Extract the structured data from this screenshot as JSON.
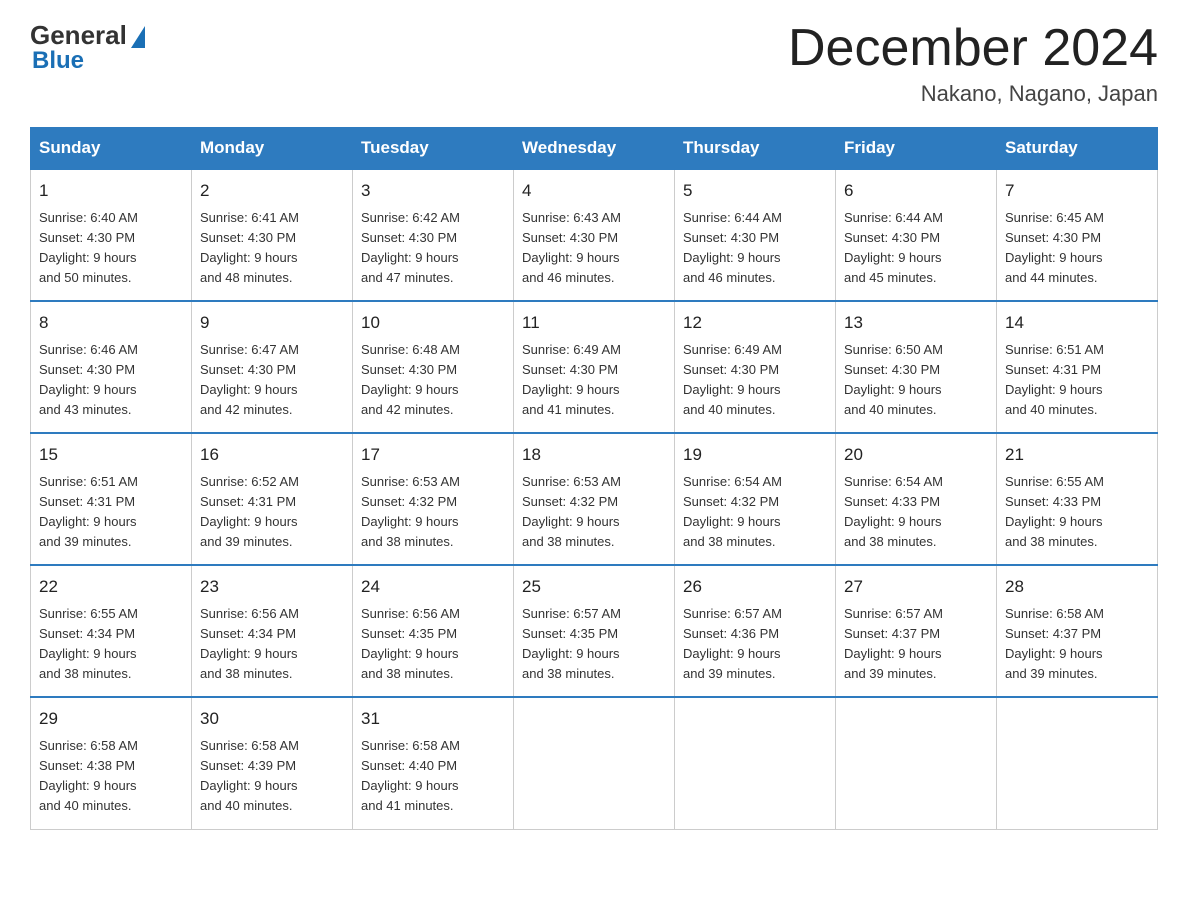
{
  "logo": {
    "general": "General",
    "blue": "Blue"
  },
  "header": {
    "title": "December 2024",
    "subtitle": "Nakano, Nagano, Japan"
  },
  "days_of_week": [
    "Sunday",
    "Monday",
    "Tuesday",
    "Wednesday",
    "Thursday",
    "Friday",
    "Saturday"
  ],
  "weeks": [
    [
      {
        "day": "1",
        "sunrise": "6:40 AM",
        "sunset": "4:30 PM",
        "daylight": "9 hours and 50 minutes."
      },
      {
        "day": "2",
        "sunrise": "6:41 AM",
        "sunset": "4:30 PM",
        "daylight": "9 hours and 48 minutes."
      },
      {
        "day": "3",
        "sunrise": "6:42 AM",
        "sunset": "4:30 PM",
        "daylight": "9 hours and 47 minutes."
      },
      {
        "day": "4",
        "sunrise": "6:43 AM",
        "sunset": "4:30 PM",
        "daylight": "9 hours and 46 minutes."
      },
      {
        "day": "5",
        "sunrise": "6:44 AM",
        "sunset": "4:30 PM",
        "daylight": "9 hours and 46 minutes."
      },
      {
        "day": "6",
        "sunrise": "6:44 AM",
        "sunset": "4:30 PM",
        "daylight": "9 hours and 45 minutes."
      },
      {
        "day": "7",
        "sunrise": "6:45 AM",
        "sunset": "4:30 PM",
        "daylight": "9 hours and 44 minutes."
      }
    ],
    [
      {
        "day": "8",
        "sunrise": "6:46 AM",
        "sunset": "4:30 PM",
        "daylight": "9 hours and 43 minutes."
      },
      {
        "day": "9",
        "sunrise": "6:47 AM",
        "sunset": "4:30 PM",
        "daylight": "9 hours and 42 minutes."
      },
      {
        "day": "10",
        "sunrise": "6:48 AM",
        "sunset": "4:30 PM",
        "daylight": "9 hours and 42 minutes."
      },
      {
        "day": "11",
        "sunrise": "6:49 AM",
        "sunset": "4:30 PM",
        "daylight": "9 hours and 41 minutes."
      },
      {
        "day": "12",
        "sunrise": "6:49 AM",
        "sunset": "4:30 PM",
        "daylight": "9 hours and 40 minutes."
      },
      {
        "day": "13",
        "sunrise": "6:50 AM",
        "sunset": "4:30 PM",
        "daylight": "9 hours and 40 minutes."
      },
      {
        "day": "14",
        "sunrise": "6:51 AM",
        "sunset": "4:31 PM",
        "daylight": "9 hours and 40 minutes."
      }
    ],
    [
      {
        "day": "15",
        "sunrise": "6:51 AM",
        "sunset": "4:31 PM",
        "daylight": "9 hours and 39 minutes."
      },
      {
        "day": "16",
        "sunrise": "6:52 AM",
        "sunset": "4:31 PM",
        "daylight": "9 hours and 39 minutes."
      },
      {
        "day": "17",
        "sunrise": "6:53 AM",
        "sunset": "4:32 PM",
        "daylight": "9 hours and 38 minutes."
      },
      {
        "day": "18",
        "sunrise": "6:53 AM",
        "sunset": "4:32 PM",
        "daylight": "9 hours and 38 minutes."
      },
      {
        "day": "19",
        "sunrise": "6:54 AM",
        "sunset": "4:32 PM",
        "daylight": "9 hours and 38 minutes."
      },
      {
        "day": "20",
        "sunrise": "6:54 AM",
        "sunset": "4:33 PM",
        "daylight": "9 hours and 38 minutes."
      },
      {
        "day": "21",
        "sunrise": "6:55 AM",
        "sunset": "4:33 PM",
        "daylight": "9 hours and 38 minutes."
      }
    ],
    [
      {
        "day": "22",
        "sunrise": "6:55 AM",
        "sunset": "4:34 PM",
        "daylight": "9 hours and 38 minutes."
      },
      {
        "day": "23",
        "sunrise": "6:56 AM",
        "sunset": "4:34 PM",
        "daylight": "9 hours and 38 minutes."
      },
      {
        "day": "24",
        "sunrise": "6:56 AM",
        "sunset": "4:35 PM",
        "daylight": "9 hours and 38 minutes."
      },
      {
        "day": "25",
        "sunrise": "6:57 AM",
        "sunset": "4:35 PM",
        "daylight": "9 hours and 38 minutes."
      },
      {
        "day": "26",
        "sunrise": "6:57 AM",
        "sunset": "4:36 PM",
        "daylight": "9 hours and 39 minutes."
      },
      {
        "day": "27",
        "sunrise": "6:57 AM",
        "sunset": "4:37 PM",
        "daylight": "9 hours and 39 minutes."
      },
      {
        "day": "28",
        "sunrise": "6:58 AM",
        "sunset": "4:37 PM",
        "daylight": "9 hours and 39 minutes."
      }
    ],
    [
      {
        "day": "29",
        "sunrise": "6:58 AM",
        "sunset": "4:38 PM",
        "daylight": "9 hours and 40 minutes."
      },
      {
        "day": "30",
        "sunrise": "6:58 AM",
        "sunset": "4:39 PM",
        "daylight": "9 hours and 40 minutes."
      },
      {
        "day": "31",
        "sunrise": "6:58 AM",
        "sunset": "4:40 PM",
        "daylight": "9 hours and 41 minutes."
      },
      null,
      null,
      null,
      null
    ]
  ],
  "labels": {
    "sunrise": "Sunrise:",
    "sunset": "Sunset:",
    "daylight": "Daylight:"
  }
}
